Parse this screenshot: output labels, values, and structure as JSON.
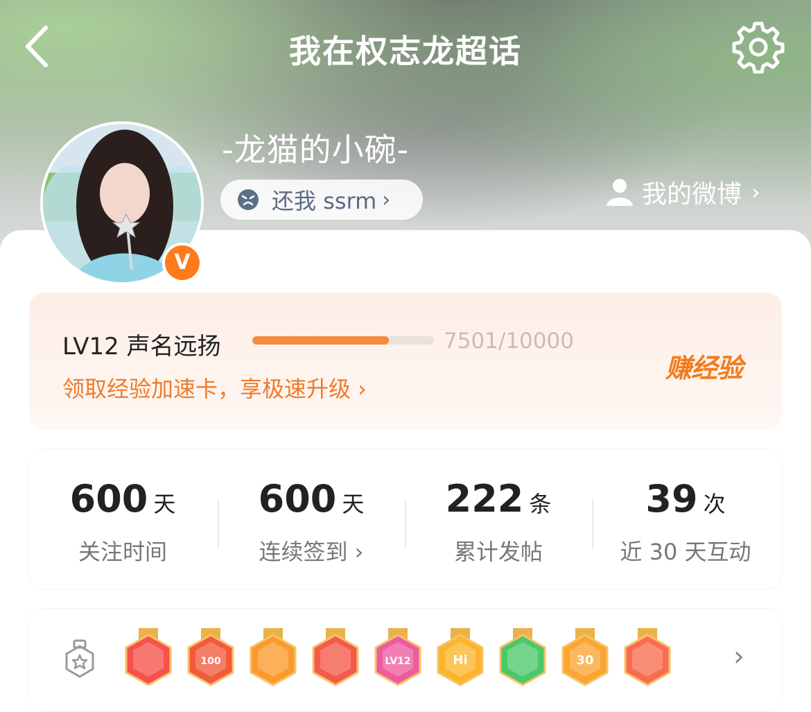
{
  "header": {
    "title": "我在权志龙超话"
  },
  "profile": {
    "username": "-龙猫的小碗-",
    "status_text": "还我 ssrm",
    "status_chevron": "›",
    "verified_badge": "V",
    "my_weibo_label": "我的微博",
    "my_weibo_chevron": "›"
  },
  "level": {
    "label": "LV12 声名远扬",
    "progress": 0.7501,
    "progress_text": "7501/10000",
    "promo_text": "领取经验加速卡，享极速升级 ›",
    "earn_label": "赚经验",
    "colors": {
      "accent": "#f58a3d",
      "promo": "#f07a2a"
    }
  },
  "stats": [
    {
      "value": "600",
      "unit": "天",
      "label": "关注时间"
    },
    {
      "value": "600",
      "unit": "天",
      "label": "连续签到 ›"
    },
    {
      "value": "222",
      "unit": "条",
      "label": "累计发帖"
    },
    {
      "value": "39",
      "unit": "次",
      "label": "近 30 天互动"
    }
  ],
  "badges": {
    "items": [
      {
        "name": "rabbit-medal",
        "color": "#f4524a",
        "text": ""
      },
      {
        "name": "100-days-medal",
        "color": "#f25a3c",
        "text": "100"
      },
      {
        "name": "crown-medal",
        "color": "#fb9a2c",
        "text": ""
      },
      {
        "name": "cat-medal",
        "color": "#f45a4a",
        "text": ""
      },
      {
        "name": "lv12-medal",
        "color": "#ee5b9e",
        "text": "LV12"
      },
      {
        "name": "hi-medal",
        "color": "#fbb52c",
        "text": "Hi"
      },
      {
        "name": "hand-medal",
        "color": "#4cc86a",
        "text": ""
      },
      {
        "name": "30-days-medal",
        "color": "#fba431",
        "text": "30"
      },
      {
        "name": "rock-hand-medal",
        "color": "#f86d4f",
        "text": ""
      }
    ],
    "chevron": "›"
  }
}
